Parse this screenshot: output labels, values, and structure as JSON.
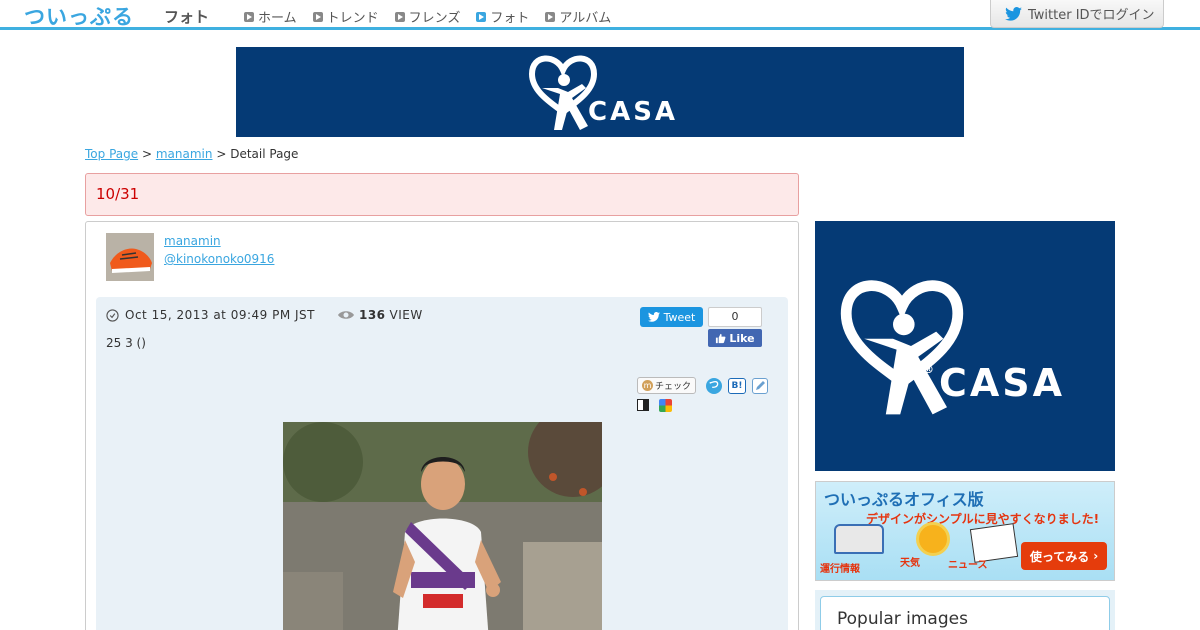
{
  "header": {
    "logo": "ついっぷる",
    "section_title": "フォト",
    "nav": [
      {
        "label": "ホーム",
        "active": false
      },
      {
        "label": "トレンド",
        "active": false
      },
      {
        "label": "フレンズ",
        "active": false
      },
      {
        "label": "フォト",
        "active": true
      },
      {
        "label": "アルバム",
        "active": false
      }
    ],
    "login_label": "Twitter IDでログイン"
  },
  "ads": {
    "casa_text": "CASA",
    "registered_mark": "®"
  },
  "breadcrumb": {
    "top": "Top Page",
    "sep": ">",
    "user": "manamin",
    "current": "Detail Page"
  },
  "post": {
    "title": "10/31",
    "user_name": "manamin",
    "user_handle": "@kinokonoko0916",
    "date": "Oct 15, 2013 at 09:49 PM JST",
    "view_count": "136",
    "view_label": "VIEW",
    "caption": "25 3 ()",
    "tweet_label": "Tweet",
    "like_count": "0",
    "like_label": "Like",
    "check_label": "チェック"
  },
  "sidebar": {
    "office_title": "ついっぷるオフィス版",
    "office_sub": "デザインがシンプルに見やすくなりました!",
    "office_try": "使ってみる",
    "office_labels": [
      "運行情報",
      "天気",
      "ニュース"
    ],
    "popular_title": "Popular images"
  },
  "colors": {
    "accent": "#3aa6e0",
    "casa_blue": "#053a75",
    "title_red": "#cc0000",
    "facebook": "#4267b2",
    "twitter": "#1b95e0"
  }
}
